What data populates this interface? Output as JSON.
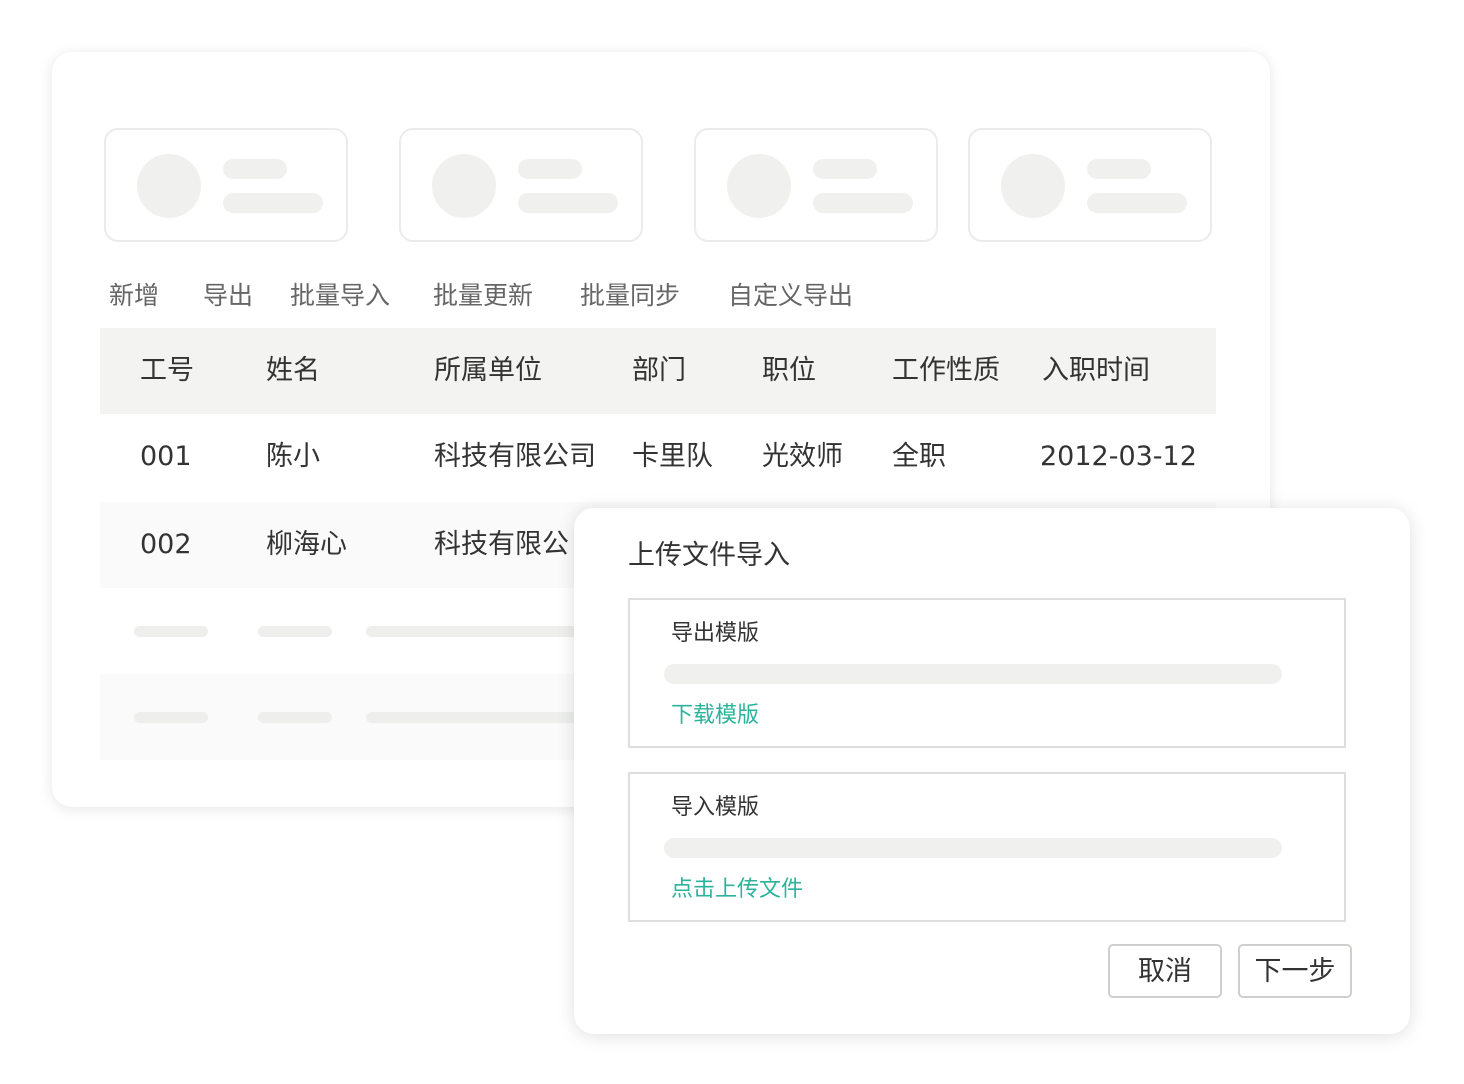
{
  "toolbar": {
    "add": "新增",
    "export": "导出",
    "batch_import": "批量导入",
    "batch_update": "批量更新",
    "batch_sync": "批量同步",
    "custom_export": "自定义导出"
  },
  "table": {
    "headers": [
      "工号",
      "姓名",
      "所属单位",
      "部门",
      "职位",
      "工作性质",
      "入职时间"
    ],
    "rows": [
      [
        "001",
        "陈小",
        "科技有限公司",
        "卡里队",
        "光效师",
        "全职",
        "2012-03-12"
      ],
      [
        "002",
        "柳海心",
        "科技有限公",
        "",
        "",
        "",
        ""
      ]
    ]
  },
  "dialog": {
    "title": "上传文件导入",
    "export_section": {
      "label": "导出模版",
      "link": "下载模版"
    },
    "import_section": {
      "label": "导入模版",
      "link": "点击上传文件"
    },
    "cancel_label": "取消",
    "next_label": "下一步"
  },
  "colors": {
    "accent": "#2db39b",
    "header_bg": "#f3f4f2",
    "skeleton": "#f0f1ef"
  }
}
